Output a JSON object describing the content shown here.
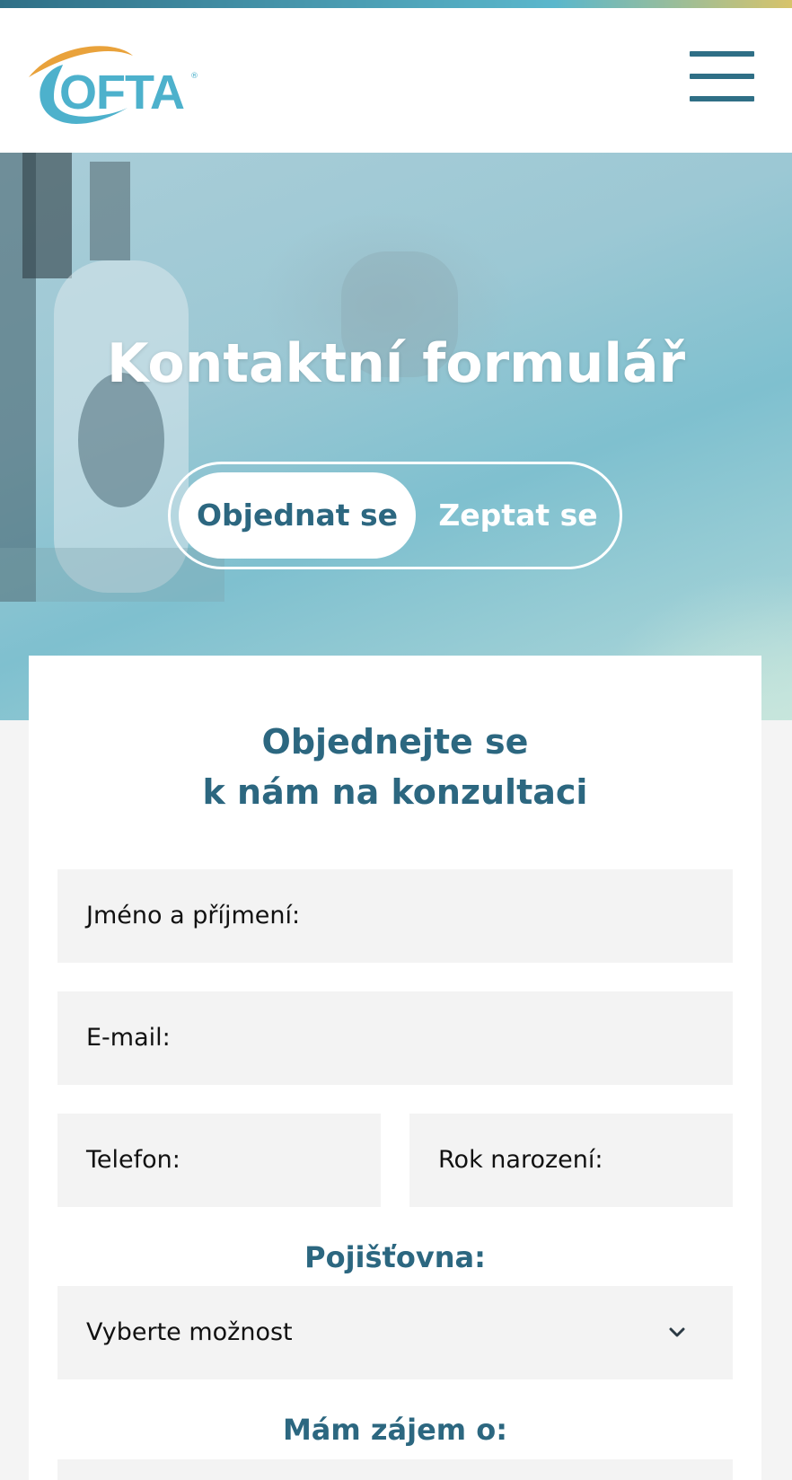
{
  "brand": {
    "logo_text": "OFTA",
    "registered_mark": "®",
    "colors": {
      "primary": "#2c6780",
      "logo_blue": "#4db1cc",
      "logo_orange": "#e9a23b",
      "field_bg": "#f3f3f3"
    }
  },
  "header": {
    "menu_icon": "hamburger-icon"
  },
  "hero": {
    "title": "Kontaktní formulář",
    "toggle": {
      "options": [
        {
          "label": "Objednat se",
          "active": true
        },
        {
          "label": "Zeptat se",
          "active": false
        }
      ]
    }
  },
  "form": {
    "heading_line1": "Objednejte se",
    "heading_line2": "k nám na konzultaci",
    "fields": {
      "name_placeholder": "Jméno a příjmení:",
      "email_placeholder": "E-mail:",
      "phone_placeholder": "Telefon:",
      "birth_year_placeholder": "Rok narození:"
    },
    "insurance": {
      "label": "Pojišťovna:",
      "selected": "Vyberte možnost",
      "icon": "chevron-down-icon"
    },
    "interest": {
      "label": "Mám zájem o:"
    }
  }
}
